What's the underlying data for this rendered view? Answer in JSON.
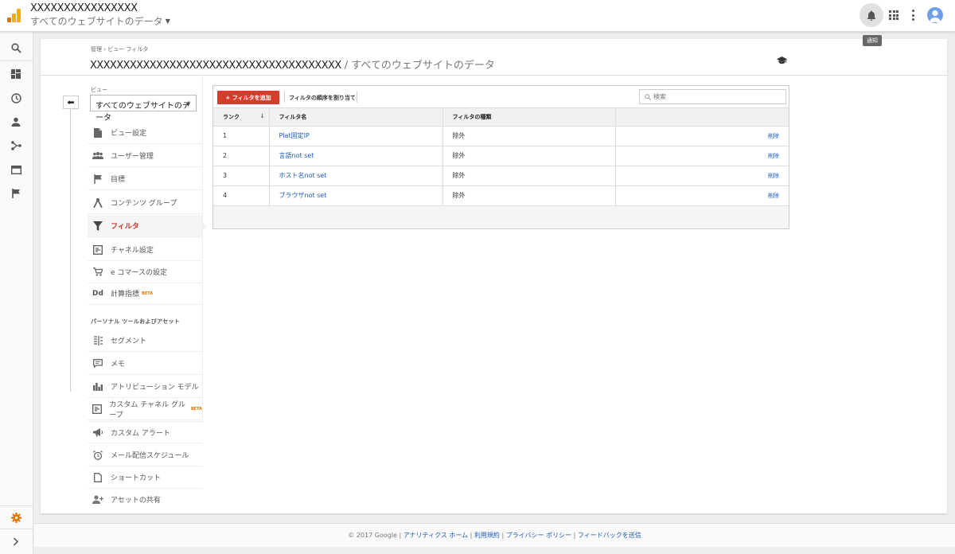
{
  "header": {
    "account_name": "XXXXXXXXXXXXXXXX",
    "property_selector": "すべてのウェブサイトのデータ",
    "notification_tooltip": "通知"
  },
  "breadcrumbs": "管理 › ビュー フィルタ",
  "page_heading": {
    "account": "XXXXXXXXXXXXXXXXXXXXXXXXXXXXXXXXXXXXXX",
    "separator": " / ",
    "view": "すべてのウェブサイトのデータ"
  },
  "view_panel": {
    "label": "ビュー",
    "selected": "すべてのウェブサイトのデータ"
  },
  "nav": {
    "items": [
      {
        "label": "ビュー設定",
        "icon": "document-icon"
      },
      {
        "label": "ユーザー管理",
        "icon": "users-icon"
      },
      {
        "label": "目標",
        "icon": "flag-icon"
      },
      {
        "label": "コンテンツ グループ",
        "icon": "content-group-icon"
      },
      {
        "label": "フィルタ",
        "icon": "filter-icon",
        "active": true
      },
      {
        "label": "チャネル設定",
        "icon": "channel-icon"
      },
      {
        "label": "e コマースの設定",
        "icon": "cart-icon"
      },
      {
        "label": "計算指標",
        "icon": "calc-icon",
        "beta": "BETA"
      }
    ],
    "section_title": "パーソナル ツールおよびアセット",
    "personal_items": [
      {
        "label": "セグメント",
        "icon": "segment-icon"
      },
      {
        "label": "メモ",
        "icon": "note-icon"
      },
      {
        "label": "アトリビューション モデル",
        "icon": "bar-chart-icon"
      },
      {
        "label": "カスタム チャネル グループ",
        "icon": "channel-icon",
        "beta": "BETA"
      },
      {
        "label": "カスタム アラート",
        "icon": "megaphone-icon"
      },
      {
        "label": "メール配信スケジュール",
        "icon": "alarm-icon"
      },
      {
        "label": "ショートカット",
        "icon": "shortcut-icon"
      },
      {
        "label": "アセットの共有",
        "icon": "add-user-icon"
      }
    ]
  },
  "filters": {
    "add_button": "+ フィルタを追加",
    "reorder_button": "フィルタの順序を割り当て",
    "search_placeholder": "検索",
    "columns": [
      "ランク",
      "フィルタ名",
      "フィルタの種類",
      ""
    ],
    "rows": [
      {
        "rank": "1",
        "name": "Plat固定IP",
        "type": "除外",
        "action": "削除"
      },
      {
        "rank": "2",
        "name": "言語not set",
        "type": "除外",
        "action": "削除"
      },
      {
        "rank": "3",
        "name": "ホスト名not set",
        "type": "除外",
        "action": "削除"
      },
      {
        "rank": "4",
        "name": "ブラウザnot set",
        "type": "除外",
        "action": "削除"
      }
    ]
  },
  "footer": {
    "copyright": "© 2017 Google | ",
    "links": [
      "アナリティクス ホーム",
      "利用規約",
      "プライバシー ポリシー",
      "フィードバックを送信"
    ]
  },
  "colors": {
    "brand_orange": "#f9ab00",
    "primary_red": "#d63b2b",
    "link_blue": "#1a5bbf"
  }
}
